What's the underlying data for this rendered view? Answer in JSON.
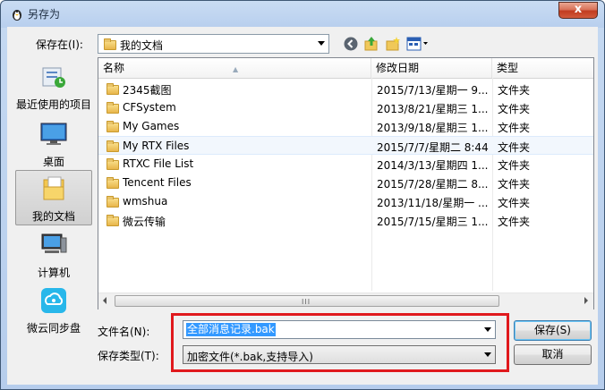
{
  "window": {
    "title": "另存为",
    "close_glyph": "x"
  },
  "toolbar": {
    "save_in_label": "保存在(I):",
    "location": "我的文档"
  },
  "places": [
    {
      "label": "最近使用的项目",
      "icon": "recent-items-icon"
    },
    {
      "label": "桌面",
      "icon": "desktop-icon"
    },
    {
      "label": "我的文档",
      "icon": "documents-icon",
      "selected": true
    },
    {
      "label": "计算机",
      "icon": "computer-icon"
    },
    {
      "label": "微云同步盘",
      "icon": "weiyun-icon"
    }
  ],
  "list": {
    "columns": [
      "名称",
      "修改日期",
      "类型"
    ],
    "rows": [
      {
        "name": "2345截图",
        "date": "2015/7/13/星期一 9...",
        "type": "文件夹"
      },
      {
        "name": "CFSystem",
        "date": "2013/8/21/星期三 1...",
        "type": "文件夹"
      },
      {
        "name": "My Games",
        "date": "2013/9/18/星期三 1...",
        "type": "文件夹"
      },
      {
        "name": "My RTX Files",
        "date": "2015/7/7/星期二 8:44",
        "type": "文件夹",
        "highlighted": true
      },
      {
        "name": "RTXC File List",
        "date": "2014/3/13/星期四 1...",
        "type": "文件夹"
      },
      {
        "name": "Tencent Files",
        "date": "2015/7/28/星期二 8...",
        "type": "文件夹"
      },
      {
        "name": "wmshua",
        "date": "2013/11/18/星期一 ...",
        "type": "文件夹"
      },
      {
        "name": "微云传输",
        "date": "2015/7/15/星期三 1...",
        "type": "文件夹"
      }
    ],
    "scroll_grip": "III"
  },
  "form": {
    "filename_label": "文件名(N):",
    "filename_value": "全部消息记录.bak",
    "filetype_label": "保存类型(T):",
    "filetype_value": "加密文件(*.bak,支持导入)",
    "save_button": "保存(S)",
    "cancel_button": "取消"
  },
  "colors": {
    "highlight_box": "#e0191d",
    "selection": "#3399ff"
  }
}
